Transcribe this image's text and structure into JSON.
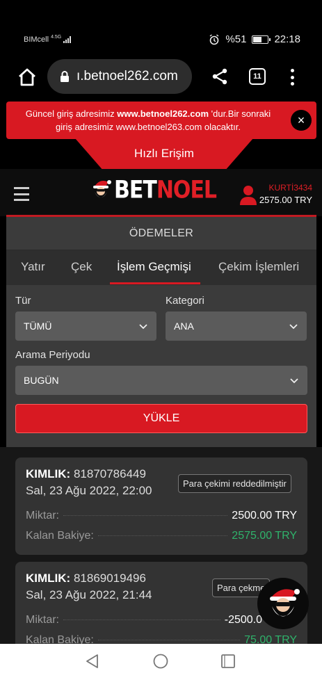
{
  "status": {
    "carrier": "BIMcell",
    "network": "4.5G",
    "battery": "%51",
    "battery_level": 0.51,
    "time": "22:18"
  },
  "browser": {
    "url": "ı.betnoel262.com",
    "tab_count": "11"
  },
  "notice": {
    "line1_pre": "Güncel giriş adresimiz ",
    "line1_bold": "www.betnoel262.com",
    "line1_post": " 'dur.Bir sonraki",
    "line2": "giriş adresimiz www.betnoel263.com olacaktır.",
    "close": "×"
  },
  "quick_access": "Hızlı Erişim",
  "header": {
    "logo_white": "BET",
    "logo_red": "NOEL",
    "username": "KURTİ3434",
    "balance": "2575.00 TRY"
  },
  "payments": {
    "title": "ÖDEMELER",
    "tabs": [
      "Yatır",
      "Çek",
      "İşlem Geçmişi",
      "Çekim İşlemleri"
    ],
    "active_tab": "İşlem Geçmişi"
  },
  "filters": {
    "type_label": "Tür",
    "type_value": "TÜMÜ",
    "category_label": "Kategori",
    "category_value": "ANA",
    "period_label": "Arama Periyodu",
    "period_value": "BUGÜN",
    "load_button": "YÜKLE"
  },
  "transactions": [
    {
      "id_label": "KIMLIK:",
      "id": "81870786449",
      "date": "Sal, 23 Ağu 2022, 22:00",
      "status": "Para çekimi reddedilmiştir",
      "amount_label": "Miktar:",
      "amount": "2500.00 TRY",
      "balance_label": "Kalan Bakiye:",
      "balance": "2575.00 TRY"
    },
    {
      "id_label": "KIMLIK:",
      "id": "81869019496",
      "date": "Sal, 23 Ağu 2022, 21:44",
      "status": "Para çekme",
      "amount_label": "Miktar:",
      "amount": "-2500.0",
      "balance_label": "Kalan Bakiye:",
      "balance": "75.00 TRY"
    }
  ],
  "colors": {
    "brand_red": "#d81922",
    "positive_green": "#2fb36b",
    "panel_bg": "#3b3b3b"
  }
}
